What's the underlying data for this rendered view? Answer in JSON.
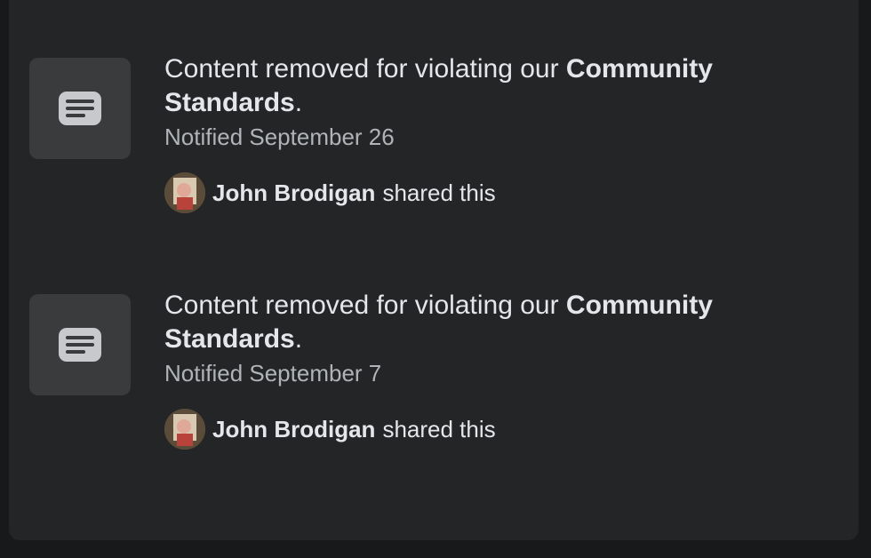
{
  "notifications": [
    {
      "icon": "message-icon",
      "title_prefix": "Content removed for violating our",
      "title_link": "Community Standards",
      "title_suffix": ".",
      "date": "Notified September 26",
      "sharer_name": "John Brodigan",
      "shared_text": "shared this"
    },
    {
      "icon": "message-icon",
      "title_prefix": "Content removed for violating our",
      "title_link": "Community Standards",
      "title_suffix": ".",
      "date": "Notified September 7",
      "sharer_name": "John Brodigan",
      "shared_text": "shared this"
    }
  ],
  "colors": {
    "background": "#18191a",
    "card": "#242526",
    "thumb": "#3a3b3c",
    "primary_text": "#e4e6eb",
    "secondary_text": "#b0b3b8",
    "icon": "#c8c9cc"
  }
}
